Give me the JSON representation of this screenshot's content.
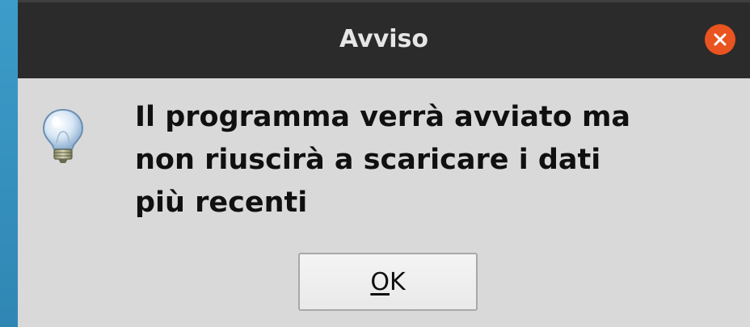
{
  "dialog": {
    "title": "Avviso",
    "message": "Il programma verrà avviato ma\nnon riuscirà a scaricare i dati\npiù recenti",
    "icon": "lightbulb-icon",
    "ok_button": {
      "mnemonic": "O",
      "rest": "K"
    },
    "close_icon": "close-icon"
  },
  "colors": {
    "titlebar": "#2b2b2b",
    "close_button": "#e95420",
    "dialog_background": "#d9d9d9",
    "desktop": "#2c7ea8"
  }
}
